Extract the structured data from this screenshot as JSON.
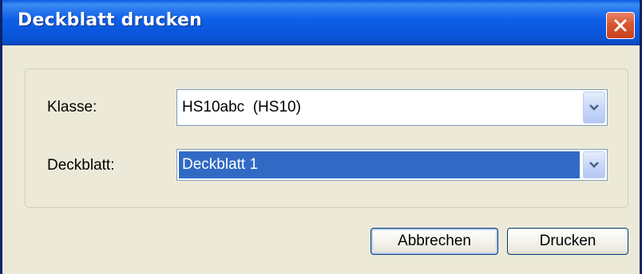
{
  "window": {
    "title": "Deckblatt drucken",
    "close_icon": "close-icon"
  },
  "form": {
    "klasse": {
      "label": "Klasse:",
      "value": "HS10abc  (HS10)"
    },
    "deckblatt": {
      "label": "Deckblatt:",
      "value": "Deckblatt 1"
    }
  },
  "buttons": {
    "cancel_label": "Abbrechen",
    "print_label": "Drucken"
  },
  "colors": {
    "titlebar": "#0a57dc",
    "window_bg": "#ece9d8",
    "selection": "#316ac5",
    "close_button": "#d9572f"
  }
}
